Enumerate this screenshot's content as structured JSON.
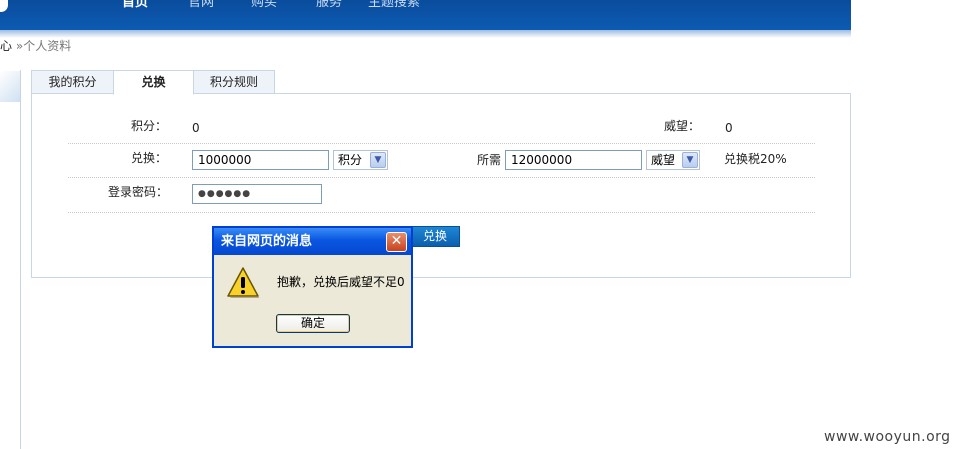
{
  "nav": {
    "items": [
      {
        "label": "首页",
        "active": true
      },
      {
        "label": "官网",
        "active": false
      },
      {
        "label": "购买",
        "active": false
      },
      {
        "label": "服务",
        "active": false
      },
      {
        "label": "主题搜索",
        "active": false
      }
    ],
    "bar_color": "#0a4c9c"
  },
  "breadcrumb": {
    "part1": "心",
    "sep": "»",
    "part2": "个人资料"
  },
  "tabs": [
    {
      "label": "我的积分",
      "active": false
    },
    {
      "label": "兑换",
      "active": true
    },
    {
      "label": "积分规则",
      "active": false
    }
  ],
  "form": {
    "points_label": "积分：",
    "points_value": "0",
    "prestige_label": "威望：",
    "prestige_value": "0",
    "exchange_label": "兑换：",
    "exchange_amount": "1000000",
    "exchange_unit": "积分",
    "required_label": "所需",
    "required_amount": "12000000",
    "required_unit": "威望",
    "tax_text": "兑换税20%",
    "password_label": "登录密码：",
    "password_value": "●●●●●●",
    "submit_label": "兑换"
  },
  "dialog": {
    "title": "来自网页的消息",
    "message": "抱歉，兑换后威望不足0",
    "ok_label": "确定",
    "close_glyph": "✕",
    "icon": "warning-icon"
  },
  "watermark": "www.wooyun.org"
}
